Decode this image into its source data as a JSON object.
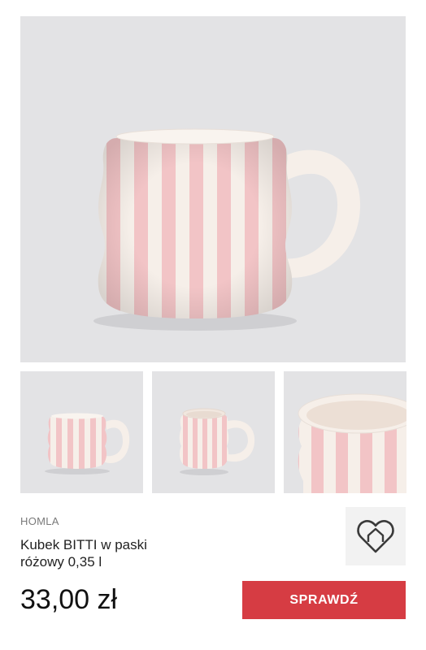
{
  "product": {
    "brand": "HOMLA",
    "title_line1": "Kubek BITTI w paski",
    "title_line2": "różowy 0,35 l",
    "price": "33,00 zł",
    "cta_label": "SPRAWDŹ"
  },
  "gallery": {
    "thumbnail_count": 3
  },
  "icons": {
    "store_logo": "heart-house-icon"
  },
  "colors": {
    "cta_background": "#d63c43",
    "image_background": "#e3e3e5",
    "stripe_pink": "#f2c4c6",
    "mug_cream": "#f6efe9"
  }
}
